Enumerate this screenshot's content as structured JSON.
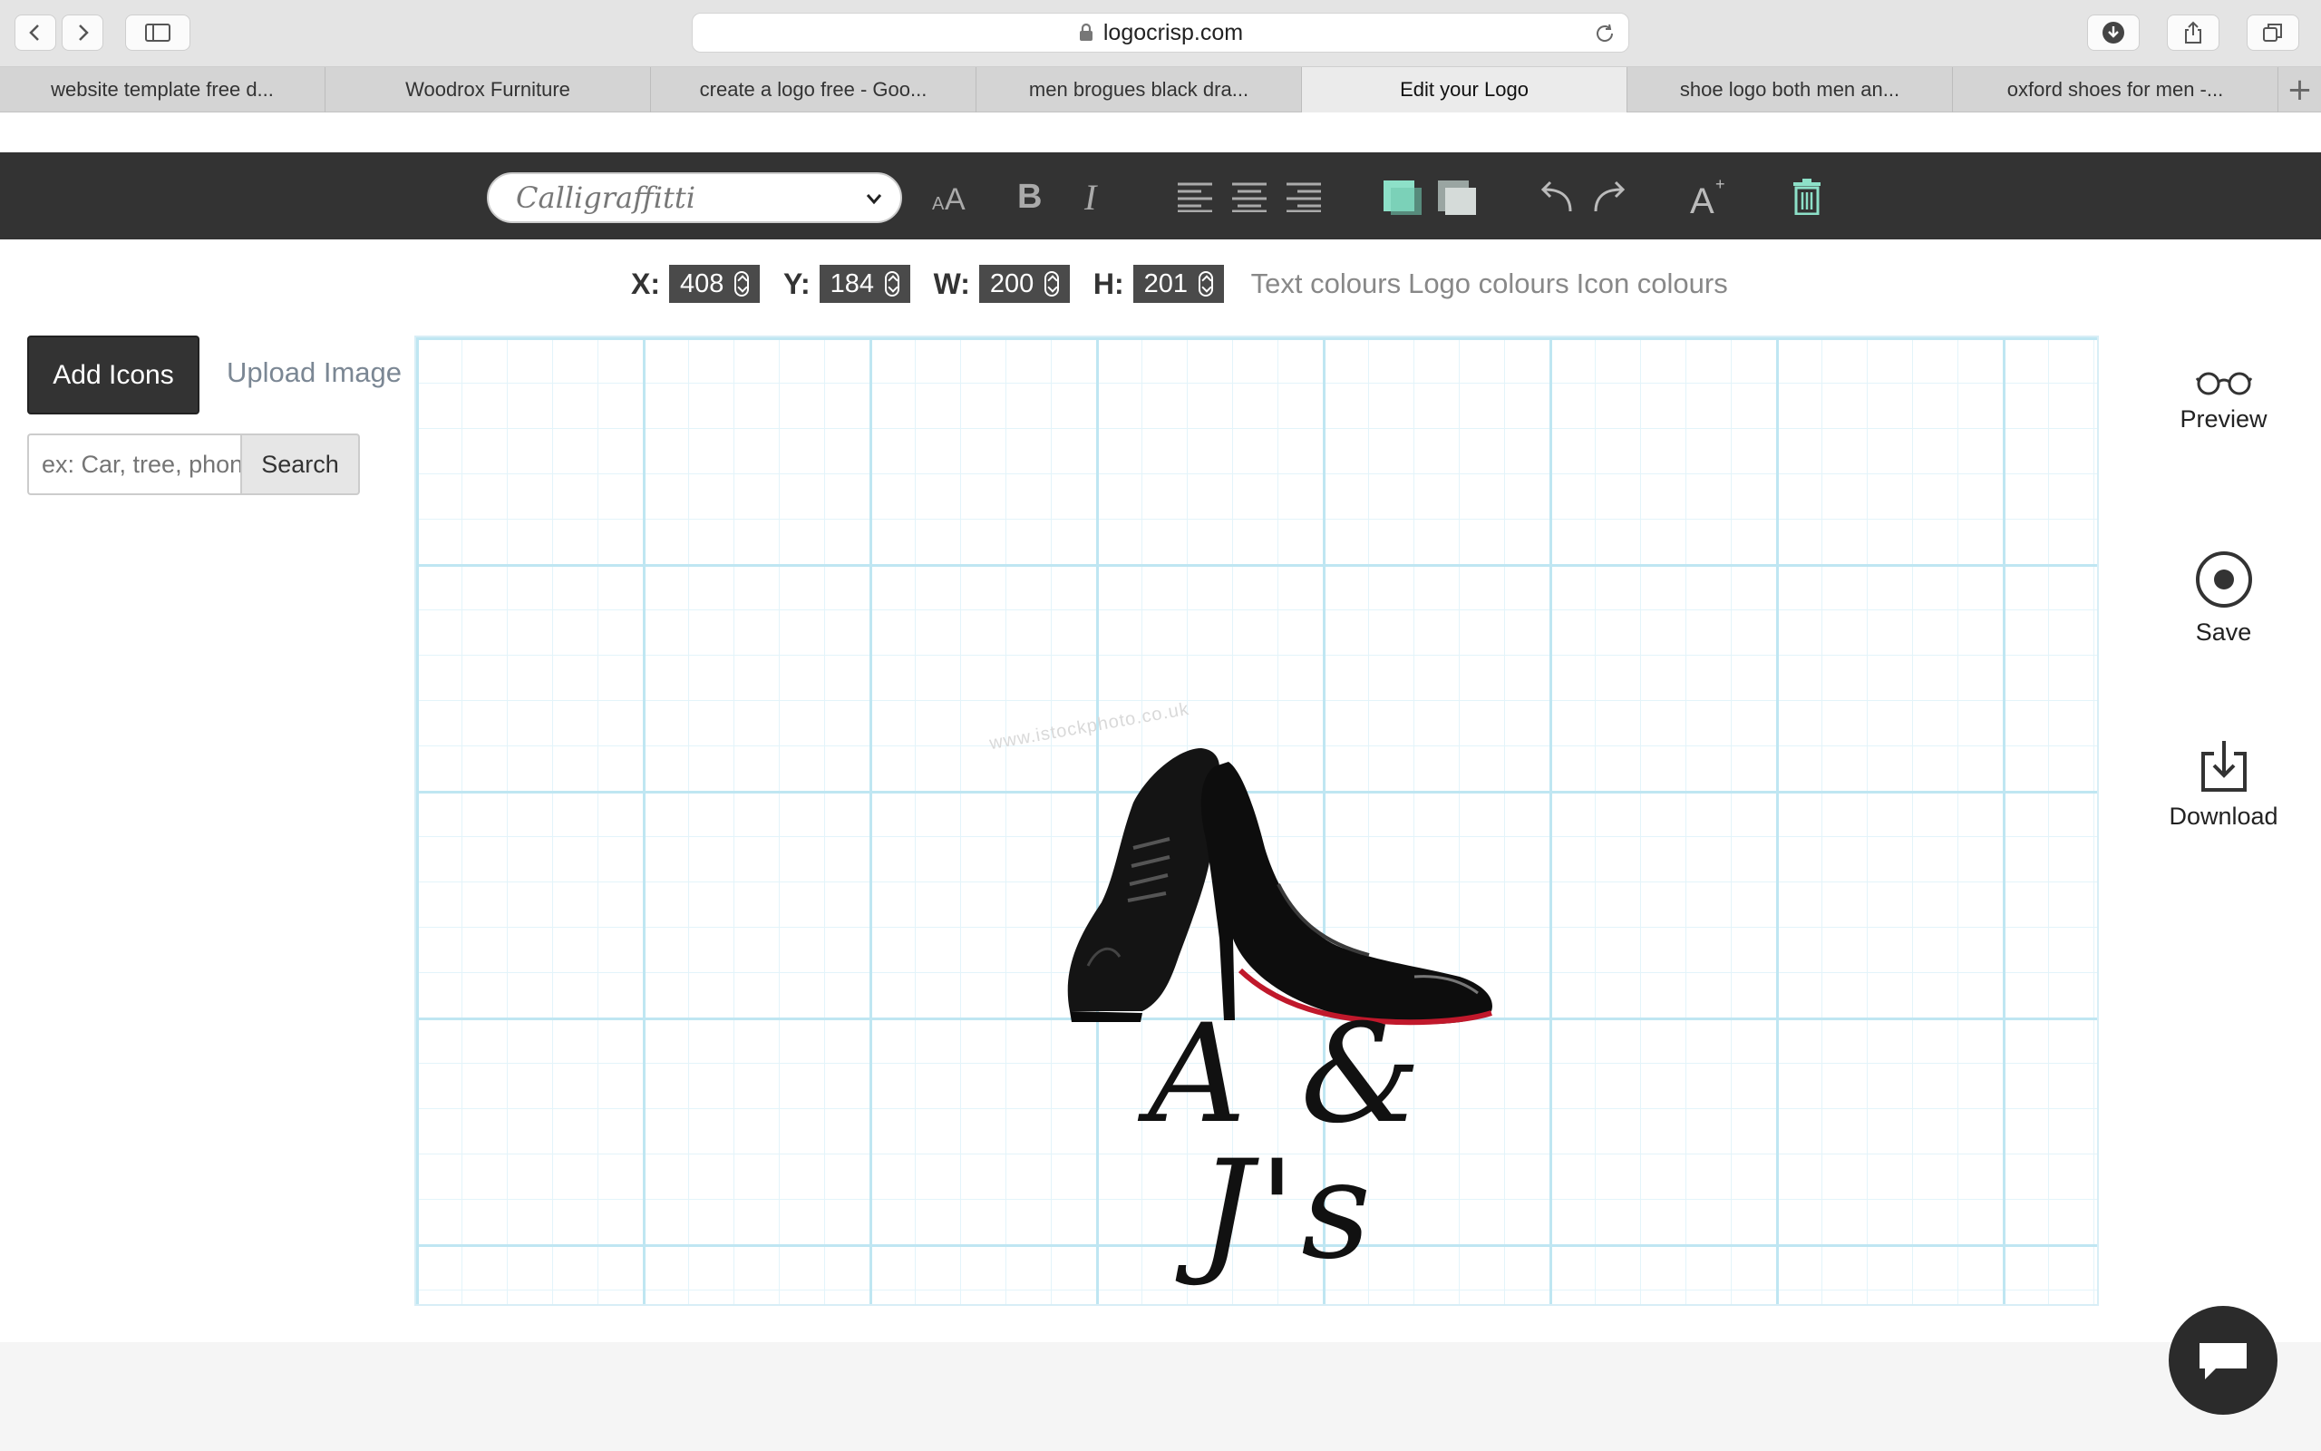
{
  "browser": {
    "url": "logocrisp.com",
    "tabs": [
      {
        "label": "website template free d...",
        "active": false
      },
      {
        "label": "Woodrox Furniture",
        "active": false
      },
      {
        "label": "create a logo free - Goo...",
        "active": false
      },
      {
        "label": "men brogues black dra...",
        "active": false
      },
      {
        "label": "Edit your Logo",
        "active": true
      },
      {
        "label": "shoe logo both men an...",
        "active": false
      },
      {
        "label": "oxford shoes for men -...",
        "active": false
      }
    ],
    "new_tab_symbol": "+"
  },
  "toolbar": {
    "font_name": "Calligraffitti",
    "font_size_icon": "font-size-icon",
    "bold_label": "B",
    "italic_label": "I",
    "add_text_label": "A",
    "colors": {
      "accent": "#8de0c8",
      "bg": "#333333"
    }
  },
  "position": {
    "x_label": "X:",
    "x_value": "408",
    "y_label": "Y:",
    "y_value": "184",
    "w_label": "W:",
    "w_value": "200",
    "h_label": "H:",
    "h_value": "201",
    "text_colours": "Text colours",
    "logo_colours": "Logo colours",
    "icon_colours": "Icon colours"
  },
  "left_panel": {
    "add_icons_label": "Add Icons",
    "upload_image_label": "Upload Image",
    "search_placeholder": "ex: Car, tree, phone",
    "search_button": "Search"
  },
  "canvas": {
    "logo_text": "A & J's",
    "watermark": "www.istockphoto.co.uk"
  },
  "right_panel": {
    "preview_label": "Preview",
    "save_label": "Save",
    "download_label": "Download"
  }
}
